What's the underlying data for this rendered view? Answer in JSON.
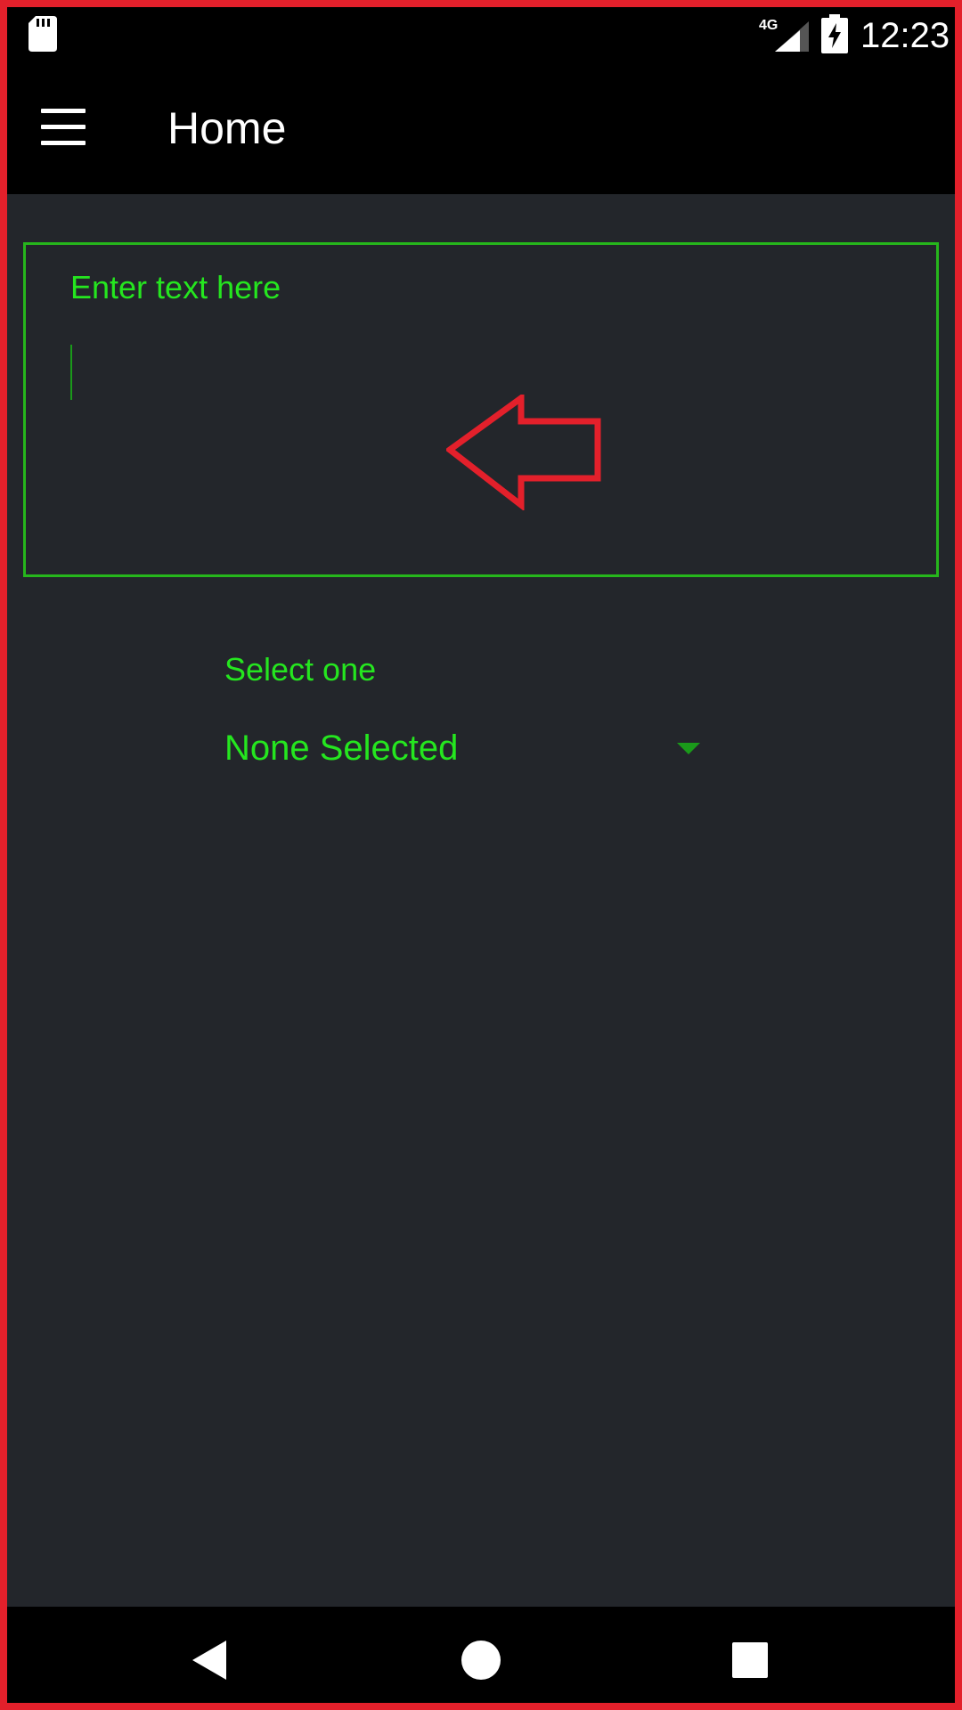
{
  "status_bar": {
    "network_label": "4G",
    "time": "12:23",
    "icons": [
      "sd-card-icon",
      "signal-icon",
      "battery-charging-icon"
    ]
  },
  "app_bar": {
    "title": "Home",
    "menu_icon": "hamburger-menu-icon"
  },
  "form": {
    "text_field": {
      "label": "Enter text here",
      "value": "",
      "placeholder": ""
    },
    "select": {
      "label": "Select one",
      "selected": "None Selected",
      "icon": "chevron-down-icon"
    }
  },
  "nav_bar": {
    "icons": [
      "back-icon",
      "home-icon",
      "recents-icon"
    ]
  },
  "colors": {
    "accent": "#25e61f",
    "border": "#26b61c",
    "background": "#23262b",
    "annotation": "#e3202b"
  }
}
